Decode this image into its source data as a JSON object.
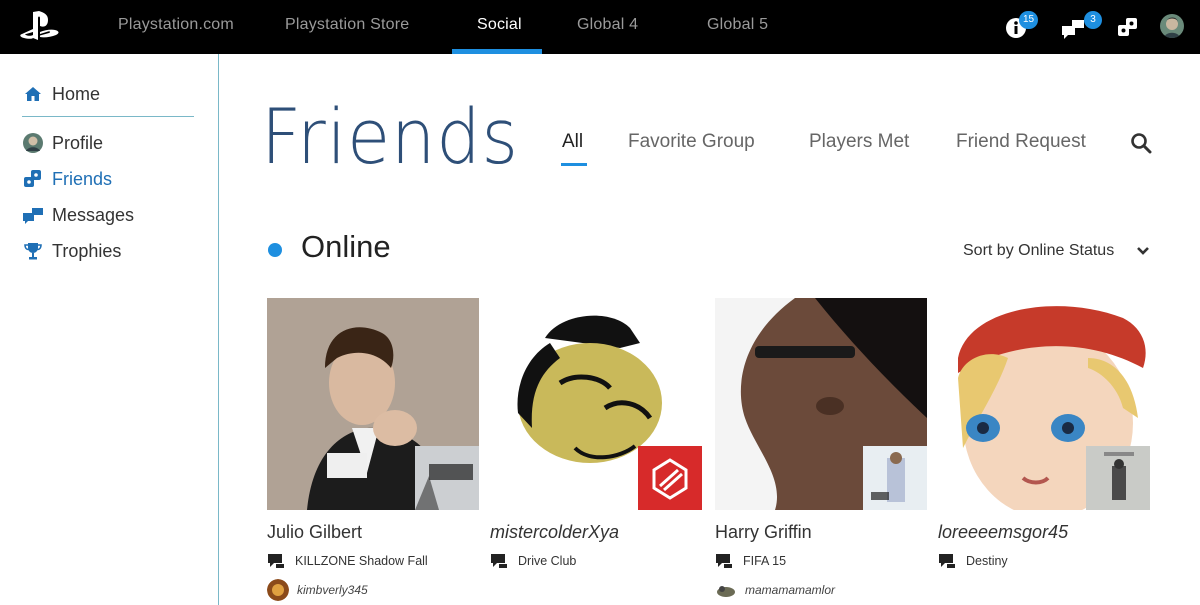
{
  "topbar": {
    "nav": [
      "Playstation.com",
      "Playstation Store",
      "Social",
      "Global 4",
      "Global 5"
    ],
    "active_nav": "Social",
    "notifications_count": "15",
    "messages_count": "3"
  },
  "sidebar": {
    "home": "Home",
    "items": [
      {
        "label": "Profile",
        "icon": "avatar-icon"
      },
      {
        "label": "Friends",
        "icon": "friends-icon"
      },
      {
        "label": "Messages",
        "icon": "messages-icon"
      },
      {
        "label": "Trophies",
        "icon": "trophy-icon"
      }
    ],
    "active": "Friends"
  },
  "main": {
    "title": "Friends",
    "tabs": [
      "All",
      "Favorite Group",
      "Players Met",
      "Friend Request"
    ],
    "active_tab": "All",
    "section": "Online",
    "sort_label": "Sort by Online Status"
  },
  "friends": [
    {
      "name": "Julio Gilbert",
      "italic": false,
      "game": "KILLZONE Shadow Fall",
      "sub": "kimbverly345"
    },
    {
      "name": "mistercolderXya",
      "italic": true,
      "game": "Drive Club",
      "sub": ""
    },
    {
      "name": "Harry Griffin",
      "italic": false,
      "game": "FIFA 15",
      "sub": "mamamamamlor"
    },
    {
      "name": "loreeeemsgor45",
      "italic": true,
      "game": "Destiny",
      "sub": ""
    }
  ],
  "colors": {
    "accent": "#1e8fe0",
    "title": "#2e4f78",
    "sidebar_active": "#1f6fb5",
    "topbar": "#000000"
  }
}
